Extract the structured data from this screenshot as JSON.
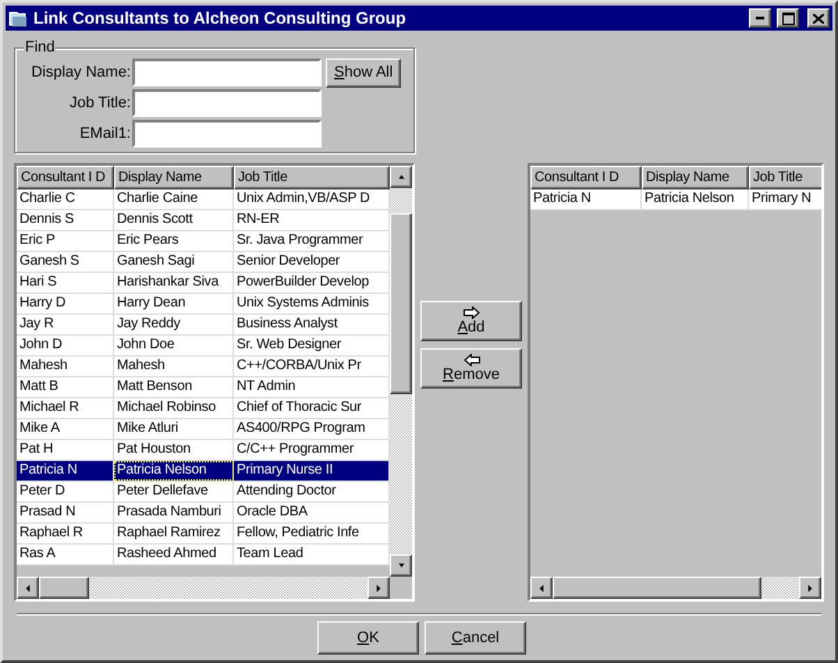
{
  "window": {
    "title": "Link Consultants to Alcheon Consulting Group"
  },
  "find": {
    "title": "Find",
    "fields": [
      {
        "label": "Display Name:"
      },
      {
        "label": "Job Title:"
      },
      {
        "label": "EMail1:"
      }
    ],
    "show_all_button": {
      "key": "S",
      "rest": "how All"
    }
  },
  "available": {
    "columns": [
      "Consultant I D",
      "Display Name",
      "Job Title"
    ],
    "rows": [
      {
        "cells": [
          "Charlie C",
          "Charlie Caine",
          "Unix Admin,VB/ASP D"
        ],
        "selected": false
      },
      {
        "cells": [
          "Dennis S",
          "Dennis Scott",
          "RN-ER"
        ],
        "selected": false
      },
      {
        "cells": [
          "Eric P",
          "Eric Pears",
          "Sr. Java Programmer"
        ],
        "selected": false
      },
      {
        "cells": [
          "Ganesh S",
          "Ganesh Sagi",
          "Senior Developer"
        ],
        "selected": false
      },
      {
        "cells": [
          "Hari S",
          "Harishankar Siva",
          "PowerBuilder Develop"
        ],
        "selected": false
      },
      {
        "cells": [
          "Harry D",
          "Harry Dean",
          "Unix Systems Adminis"
        ],
        "selected": false
      },
      {
        "cells": [
          "Jay R",
          "Jay Reddy",
          "Business Analyst"
        ],
        "selected": false
      },
      {
        "cells": [
          "John D",
          "John Doe",
          "Sr. Web Designer"
        ],
        "selected": false
      },
      {
        "cells": [
          "Mahesh",
          "Mahesh",
          "C++/CORBA/Unix Pr"
        ],
        "selected": false
      },
      {
        "cells": [
          "Matt B",
          "Matt Benson",
          "NT Admin"
        ],
        "selected": false
      },
      {
        "cells": [
          "Michael R",
          "Michael Robinso",
          "Chief of Thoracic Sur"
        ],
        "selected": false
      },
      {
        "cells": [
          "Mike A",
          "Mike Atluri",
          "AS400/RPG Program"
        ],
        "selected": false
      },
      {
        "cells": [
          "Pat H",
          "Pat Houston",
          "C/C++ Programmer"
        ],
        "selected": false
      },
      {
        "cells": [
          "Patricia N",
          "Patricia Nelson",
          "Primary Nurse II"
        ],
        "selected": true
      },
      {
        "cells": [
          "Peter D",
          "Peter Dellefave",
          "Attending Doctor"
        ],
        "selected": false
      },
      {
        "cells": [
          "Prasad N",
          "Prasada Namburi",
          "Oracle DBA"
        ],
        "selected": false
      },
      {
        "cells": [
          "Raphael R",
          "Raphael Ramirez",
          "Fellow, Pediatric Infe"
        ],
        "selected": false
      },
      {
        "cells": [
          "Ras A",
          "Rasheed Ahmed",
          "Team Lead"
        ],
        "selected": false
      }
    ]
  },
  "move_buttons": [
    {
      "key": "A",
      "rest": "dd",
      "kind": "right"
    },
    {
      "key": "R",
      "rest": "emove",
      "kind": "left"
    }
  ],
  "linked": {
    "columns": [
      "Consultant I D",
      "Display Name",
      "Job Title"
    ],
    "rows": [
      {
        "cells": [
          "Patricia N",
          "Patricia Nelson",
          "Primary N"
        ],
        "selected": false
      }
    ]
  },
  "buttons": [
    {
      "key": "O",
      "rest": "K"
    },
    {
      "key": "C",
      "rest": "ancel"
    }
  ]
}
